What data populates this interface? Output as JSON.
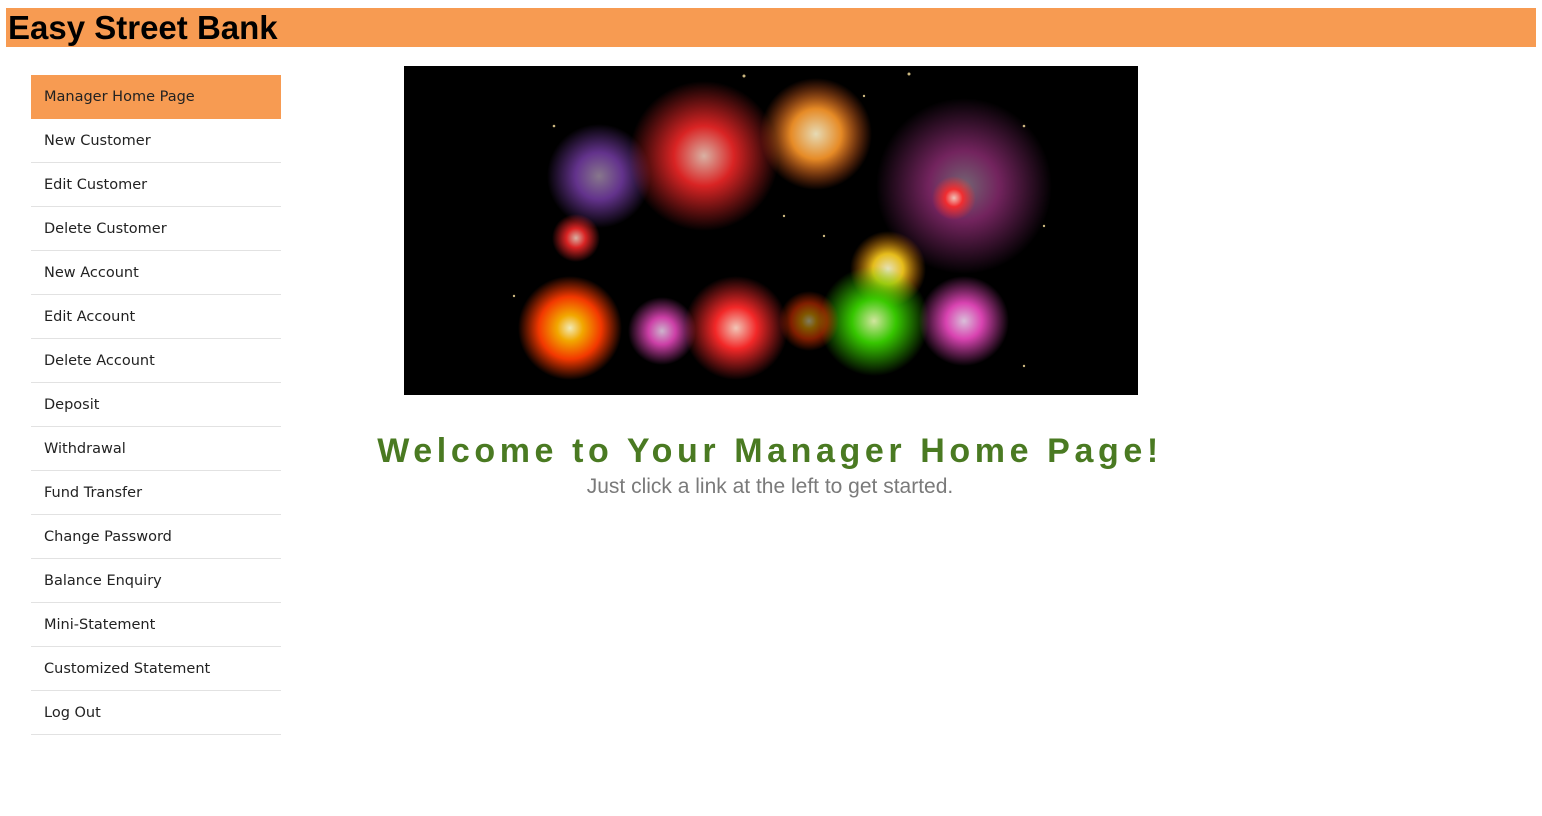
{
  "header": {
    "title": "Easy Street Bank"
  },
  "sidebar": {
    "items": [
      {
        "label": "Manager Home Page",
        "active": true
      },
      {
        "label": "New Customer"
      },
      {
        "label": "Edit Customer"
      },
      {
        "label": "Delete Customer"
      },
      {
        "label": "New Account"
      },
      {
        "label": "Edit Account"
      },
      {
        "label": "Delete Account"
      },
      {
        "label": "Deposit"
      },
      {
        "label": "Withdrawal"
      },
      {
        "label": "Fund Transfer"
      },
      {
        "label": "Change Password"
      },
      {
        "label": "Balance Enquiry"
      },
      {
        "label": "Mini-Statement"
      },
      {
        "label": "Customized Statement"
      },
      {
        "label": "Log Out"
      }
    ]
  },
  "main": {
    "hero_image": "fireworks-banner",
    "welcome_heading": "Welcome to Your Manager Home Page!",
    "welcome_subtext": "Just click a link at the left to get started."
  },
  "colors": {
    "accent": "#f79b52",
    "heading": "#4a7a22",
    "subtext": "#7a7a7a"
  }
}
